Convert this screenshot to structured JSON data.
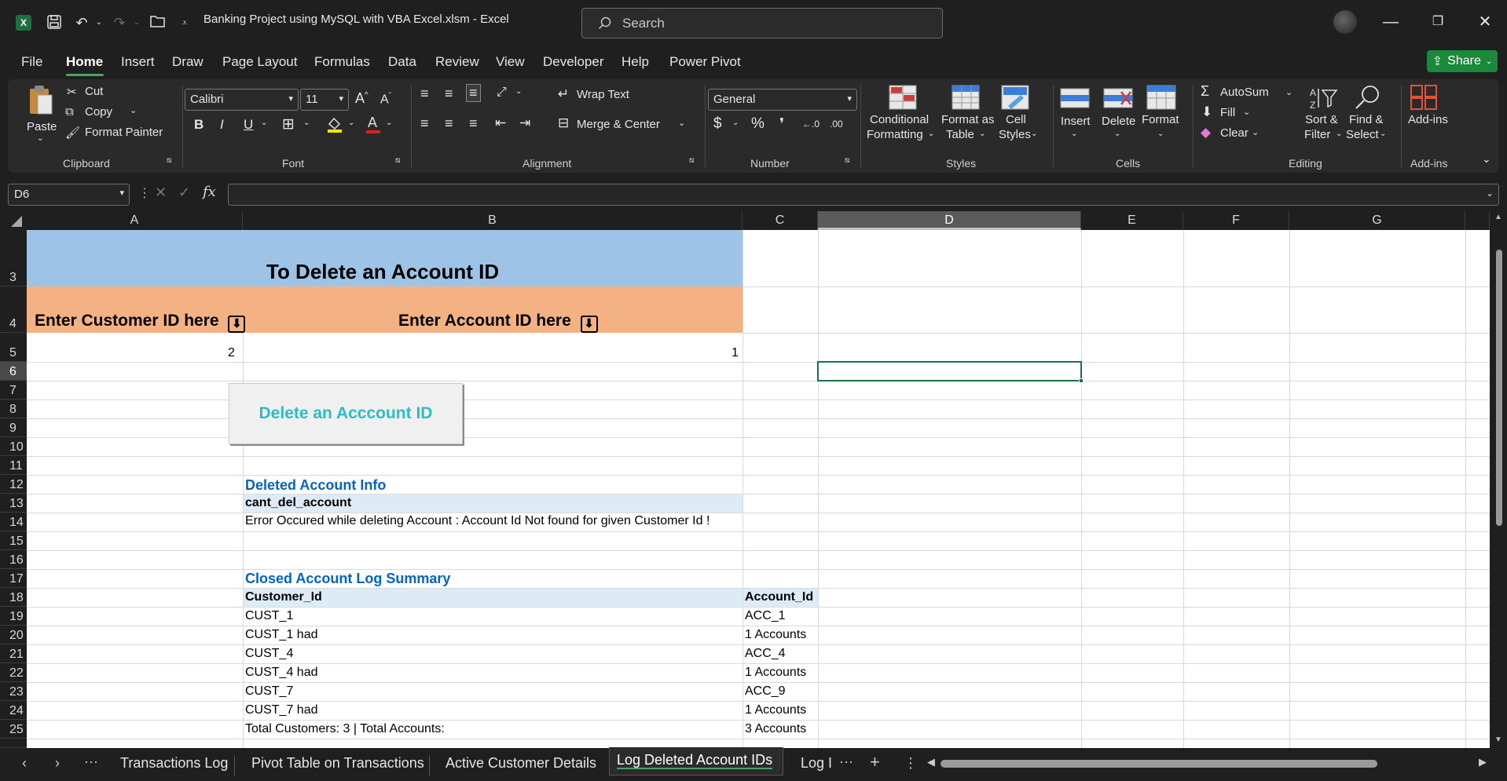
{
  "window": {
    "title": "Banking Project using MySQL with VBA Excel.xlsm  -  Excel",
    "search_placeholder": "Search"
  },
  "menu": {
    "items": [
      "File",
      "Home",
      "Insert",
      "Draw",
      "Page Layout",
      "Formulas",
      "Data",
      "Review",
      "View",
      "Developer",
      "Help",
      "Power Pivot"
    ],
    "active": "Home",
    "share_label": "Share"
  },
  "ribbon": {
    "clipboard": {
      "paste": "Paste",
      "cut": "Cut",
      "copy": "Copy",
      "format_painter": "Format Painter",
      "label": "Clipboard"
    },
    "font": {
      "name": "Calibri",
      "size": "11",
      "label": "Font",
      "bold": "B",
      "italic": "I",
      "underline": "U"
    },
    "alignment": {
      "wrap_text": "Wrap Text",
      "merge_center": "Merge & Center",
      "label": "Alignment"
    },
    "number": {
      "format": "General",
      "label": "Number"
    },
    "styles": {
      "conditional_1": "Conditional",
      "conditional_2": "Formatting",
      "format_table_1": "Format as",
      "format_table_2": "Table",
      "cell_styles_1": "Cell",
      "cell_styles_2": "Styles",
      "label": "Styles"
    },
    "cells": {
      "insert": "Insert",
      "delete": "Delete",
      "format": "Format",
      "label": "Cells"
    },
    "editing": {
      "autosum": "AutoSum",
      "fill": "Fill",
      "clear": "Clear",
      "sort_1": "Sort &",
      "sort_2": "Filter",
      "find_1": "Find &",
      "find_2": "Select",
      "label": "Editing"
    },
    "addins": {
      "addins": "Add-ins",
      "label": "Add-ins"
    }
  },
  "formula_bar": {
    "name_box": "D6",
    "value": ""
  },
  "columns": [
    "A",
    "B",
    "C",
    "D",
    "E",
    "F",
    "G"
  ],
  "selected_column": "D",
  "rows": [
    "3",
    "4",
    "5",
    "6",
    "7",
    "8",
    "9",
    "10",
    "11",
    "12",
    "13",
    "14",
    "15",
    "16",
    "17",
    "18",
    "19",
    "20",
    "21",
    "22",
    "23",
    "24",
    "25"
  ],
  "selected_row": "6",
  "sheet": {
    "title": "To Delete an Account ID",
    "customer_prompt": "Enter Customer ID here",
    "account_prompt": "Enter Account ID here",
    "customer_id_value": "2",
    "account_id_value": "1",
    "button_label": "Delete an Acccount ID",
    "deleted_info_title": "Deleted Account Info",
    "deleted_info_header": "cant_del_account",
    "deleted_info_message": "Error Occured while deleting Account : Account Id Not found for given Customer Id !",
    "log_title": "Closed Account Log Summary",
    "log_headers": [
      "Customer_Id",
      "Account_Id"
    ],
    "log_rows": [
      [
        "CUST_1",
        "ACC_1"
      ],
      [
        "CUST_1 had",
        "1 Accounts"
      ],
      [
        "CUST_4",
        "ACC_4"
      ],
      [
        "CUST_4 had",
        "1 Accounts"
      ],
      [
        "CUST_7",
        "ACC_9"
      ],
      [
        "CUST_7 had",
        "1 Accounts"
      ],
      [
        "Total Customers: 3 | Total Accounts:",
        "3 Accounts"
      ]
    ]
  },
  "tabs": {
    "items": [
      "Transactions Log",
      "Pivot Table on Transactions",
      "Active Customer Details",
      "Log Deleted Account IDs",
      "Log I"
    ],
    "active": "Log Deleted Account IDs"
  },
  "colors": {
    "title_bg": "#9dc3e6",
    "prompt_bg": "#f4b183",
    "section_title": "#0563c1",
    "table_header_bg": "#ddebf7",
    "button_text": "#2bbcc4",
    "accent": "#4aa564"
  }
}
